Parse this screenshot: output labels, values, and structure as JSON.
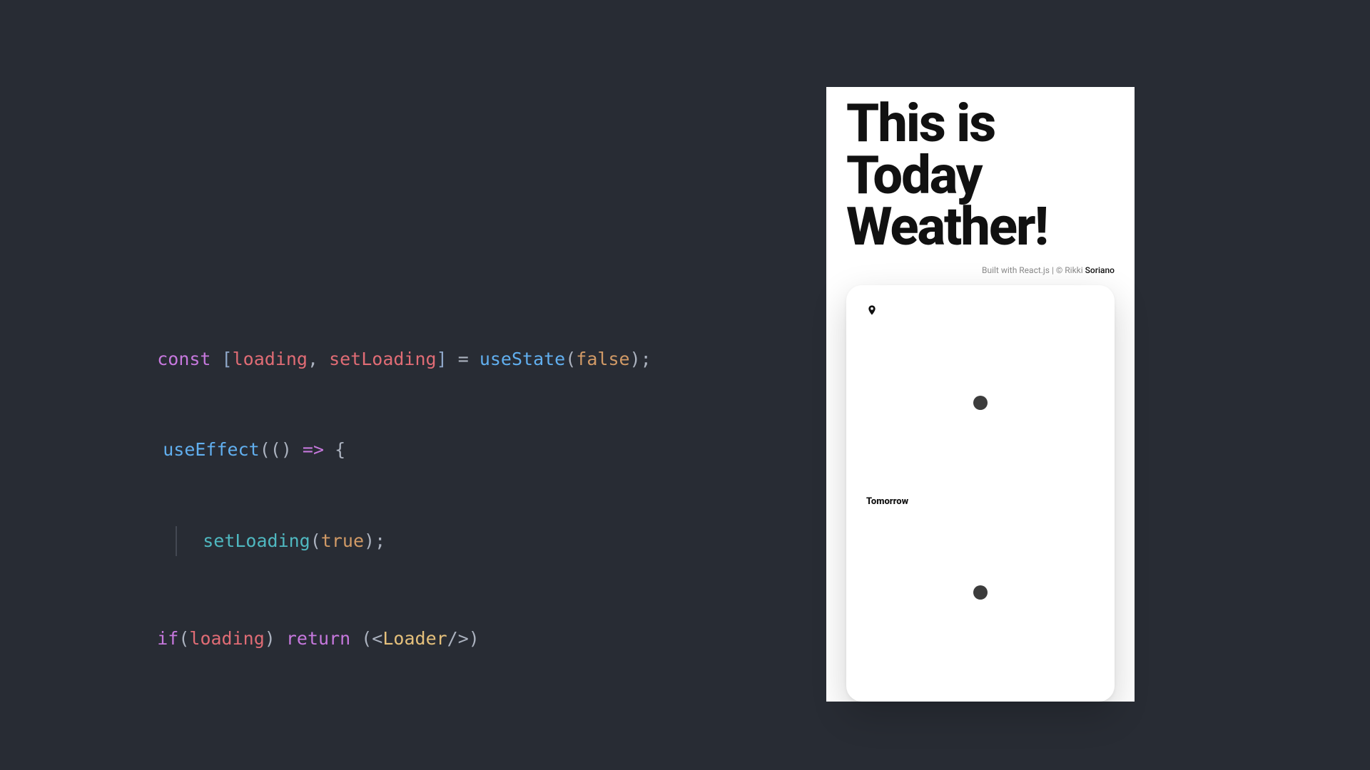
{
  "code": {
    "line1": {
      "kw_const": "const",
      "lbrack": "[",
      "var1": "loading",
      "comma": ", ",
      "var2": "setLoading",
      "rbrack": "]",
      "eq": " = ",
      "fn": "useState",
      "lparen": "(",
      "arg": "false",
      "rparen": ")",
      "semi": ";"
    },
    "line2": {
      "fn": "useEffect",
      "lparen": "(",
      "lparen2": "(",
      "rparen2": ")",
      "arrow": " => ",
      "lbrace": "{"
    },
    "line3": {
      "call": "setLoading",
      "lparen": "(",
      "arg": "true",
      "rparen": ")",
      "semi": ";"
    },
    "line4": {
      "kw_if": "if",
      "lparen": "(",
      "var": "loading",
      "rparen": ")",
      "kw_return": " return ",
      "lparen2": "(",
      "lt": "<",
      "tag": "Loader",
      "slashgt": "/>",
      "rparen2": ")"
    }
  },
  "app": {
    "title_line1": "This is",
    "title_line2": "Today",
    "title_line3": "Weather!",
    "credit_prefix": "Built with React.js | © Rikki ",
    "credit_name": "Soriano",
    "tomorrow_label": "Tomorrow"
  }
}
